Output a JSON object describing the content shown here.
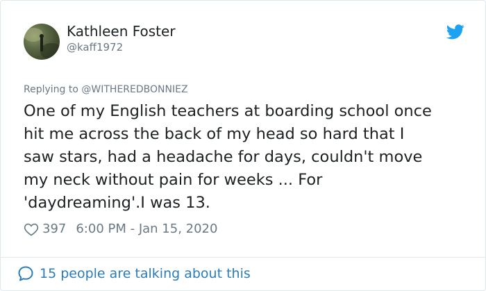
{
  "user": {
    "name": "Kathleen Foster",
    "handle": "@kaff1972"
  },
  "reply": {
    "prefix": "Replying to",
    "to": "@WITHEREDBONNIEZ"
  },
  "tweet": {
    "lines": [
      "One of my English teachers at boarding school once",
      "hit me across the back of my head so hard that I",
      "saw stars, had a headache for days, couldn't move",
      "my neck without pain for weeks ... For",
      "'daydreaming'.I was 13."
    ]
  },
  "meta": {
    "likes": "397",
    "timestamp": "6:00 PM - Jan 15, 2020"
  },
  "footer": {
    "talking": "15 people are talking about this"
  },
  "icons": {
    "bird": "twitter-bird-icon",
    "heart": "heart-icon",
    "bubble": "speech-bubble-icon"
  },
  "colors": {
    "brand": "#1da1f2",
    "link": "#2b7bb9",
    "muted": "#697882",
    "text": "#1c2022"
  }
}
